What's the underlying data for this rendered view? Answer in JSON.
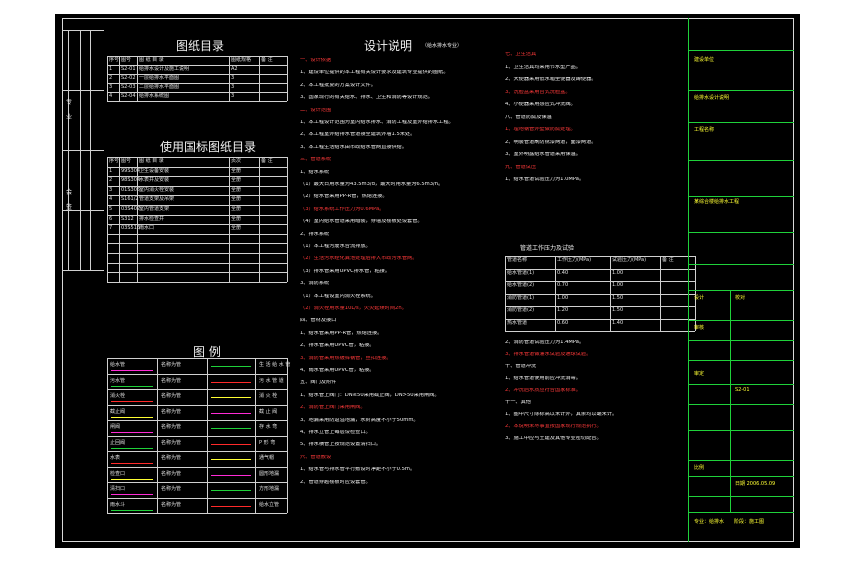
{
  "sheet": {
    "drawing_list_title": "图纸目录",
    "drawing_list_headers": [
      "序号",
      "图号",
      "图 纸 目 录",
      "图纸规格",
      "备 注"
    ],
    "drawing_list_rows": [
      [
        "1",
        "S2-01",
        "给排水设计及施工说明",
        "A2",
        ""
      ],
      [
        "2",
        "S2-02",
        "一层给排水平面图",
        "3",
        ""
      ],
      [
        "3",
        "S2-03",
        "二层给排水平面图",
        "3",
        ""
      ],
      [
        "4",
        "S2-04",
        "给排水系统图",
        "3",
        ""
      ]
    ],
    "std_list_title": "使用国标图纸目录",
    "std_list_headers": [
      "序号",
      "图号",
      "图 纸 目 录",
      "页次",
      "备 注"
    ],
    "std_list_rows": [
      [
        "1",
        "99S304",
        "卫生设备安装",
        "全册",
        ""
      ],
      [
        "2",
        "98S304",
        "水表井及安装",
        "全册",
        ""
      ],
      [
        "3",
        "01S305",
        "室内消火栓安装",
        "全册",
        ""
      ],
      [
        "4",
        "S161/2",
        "管道支架及吊架",
        "全册",
        ""
      ],
      [
        "5",
        "03S402",
        "室内管道支架",
        "全册",
        ""
      ],
      [
        "6",
        "S312",
        "排水检查井",
        "全册",
        ""
      ],
      [
        "7",
        "03S516",
        "雨水口",
        "全册",
        ""
      ]
    ],
    "legend_title": "图 例",
    "legend_rows": [
      [
        "给水管",
        "名称为管",
        "生 活 给 水 管"
      ],
      [
        "污水管",
        "名称为管",
        "污 水 管 道"
      ],
      [
        "消火栓",
        "名称为管",
        "消 火 栓"
      ],
      [
        "截止阀",
        "名称为管",
        "截 止 阀"
      ],
      [
        "闸阀",
        "名称为管",
        "存 水 弯"
      ],
      [
        "止回阀",
        "名称为管",
        "P 形 弯"
      ],
      [
        "水表",
        "名称为管",
        "通气帽"
      ],
      [
        "检查口",
        "名称为管",
        "圆形地漏"
      ],
      [
        "清扫口",
        "名称为管",
        "方形地漏"
      ],
      [
        "雨水斗",
        "名称为管",
        "给水立管"
      ]
    ],
    "design_title": "设计说明",
    "design_subtitle": "（给水排水专业）",
    "left_col_lines": [
      "一、设计依据",
      "1、建设单位提供的本工程有关设计要求及建筑专业提供的图纸。",
      "2、本工程批复的方案设计文件。",
      "3、国家现行的有关给水、排水、卫生和消防等设计规范。",
      "二、设计范围",
      "1、本工程设计范围为室内给水排水、消防工程及室外给排水工程。",
      "2、本工程室外给排水管道接至建筑外墙1.5米处。",
      "3、本工程生活给水由市政给水管网直接供给。",
      "三、管道系统",
      "1、给水系统",
      "（1）最大日用水量为43.5m3/d，最大时用水量为6.5m3/h。",
      "（2）给水管采用PP-R管，热熔连接。",
      "（3）给水系统工作压力为0.6MPa。",
      "（4）室内给水管道采用暗装，穿墙及楼板处设套管。",
      "2、排水系统",
      "（1）本工程污废水合流排放。",
      "（2）生活污水经化粪池处理后排入市政污水管网。",
      "（3）排水管采用UPVC排水管，粘接。",
      "3、消防系统",
      "（1）本工程设室内消火栓系统。",
      "（2）消火栓用水量10L/s，火灾延续时间2h。",
      "四、管材及接口",
      "1、给水管采用PP-R管，热熔连接。",
      "2、排水管采用UPVC管，粘接。",
      "3、消防管采用热镀锌钢管，丝扣连接。",
      "4、雨水管采用UPVC管，粘接。",
      "五、阀门及附件",
      "1、给水管上阀门：DN≤50采用截止阀，DN>50采用闸阀。",
      "2、消防管上阀门采用闸阀。",
      "3、地漏采用防返溢地漏，水封高度不小于50mm。",
      "4、排水立管上每层设检查口。",
      "5、排水横管上按规范设置清扫口。",
      "六、管道敷设",
      "1、给水管与排水管平行敷设时净距不小于0.5m。",
      "2、管道穿越楼板时应设套管。"
    ],
    "mid_col_lines": [
      "七、卫生洁具",
      "1、卫生洁具均采用节水型产品。",
      "2、大便器采用低水箱坐便器及蹲便器。",
      "3、洗脸盆采用台式洗脸盆。",
      "4、小便器采用感应式冲洗阀。",
      "八、管道防腐及保温",
      "1、埋地钢管外壁做防腐处理。",
      "2、明装管道刷防锈漆两道，面漆两道。",
      "3、室外明露给水管道采用保温。",
      "九、管道试压",
      "1、给水管道试验压力为1.0MPa。",
      "2、消防管道试验压力为1.4MPa。",
      "3、排水管道做灌水试验及通球试验。",
      "十、管道冲洗",
      "1、给水管道使用前应冲洗消毒。",
      "2、冲洗后水质应符合国家标准。",
      "十一、其他",
      "1、图中尺寸除标高以米计外，其余均以毫米计。",
      "2、本说明未尽事宜按国家现行规范执行。",
      "3、施工中应与土建及其他专业密切配合。"
    ],
    "pressure_table_title": "管道工作压力及试验",
    "pressure_headers": [
      "管道名称",
      "工作压力(MPa)",
      "试验压力(MPa)",
      "备 注"
    ],
    "pressure_rows": [
      [
        "给水管道(1)",
        "0.40",
        "1.00",
        ""
      ],
      [
        "给水管道(2)",
        "0.70",
        "1.00",
        ""
      ],
      [
        "消防管道(1)",
        "1.00",
        "1.50",
        ""
      ],
      [
        "消防管道(2)",
        "1.20",
        "1.50",
        ""
      ],
      [
        "热水管道",
        "0.60",
        "1.40",
        ""
      ]
    ],
    "title_block": {
      "company": "建设单位",
      "project_label": "工程名称",
      "project_name": "某综合楼给排水工程",
      "drawing_label": "图名",
      "drawing_name": "给排水设计说明",
      "designer": "设计",
      "checker": "校对",
      "reviewer": "审核",
      "approver": "审定",
      "sheet_no": "S2-01",
      "scale": "比例",
      "date": "日期 2006.05.09",
      "footer": "专业：给排水　　阶段：施工图"
    },
    "side_strip": [
      "专",
      "业",
      "会",
      "签"
    ]
  }
}
